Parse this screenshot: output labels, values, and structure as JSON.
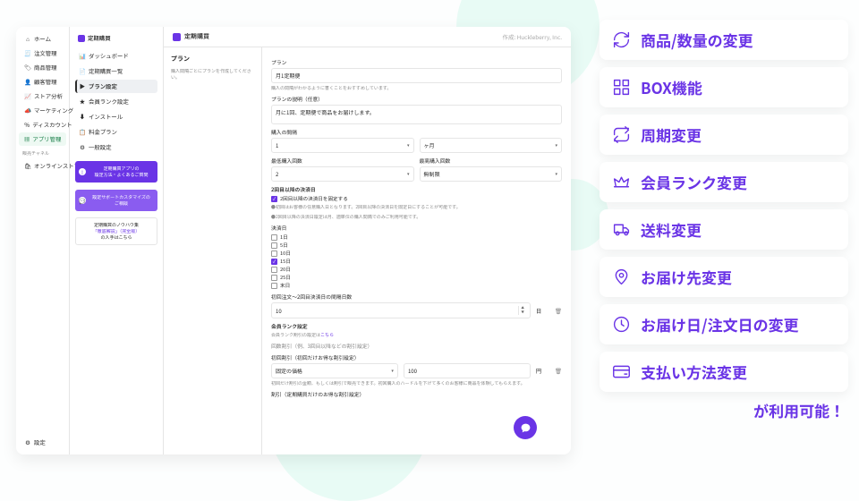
{
  "pnav": {
    "items": [
      {
        "icon": "⌂",
        "label": "ホーム"
      },
      {
        "icon": "🧾",
        "label": "注文管理"
      },
      {
        "icon": "🏷",
        "label": "商品管理"
      },
      {
        "icon": "👤",
        "label": "顧客管理"
      },
      {
        "icon": "📈",
        "label": "ストア分析"
      },
      {
        "icon": "📣",
        "label": "マーケティング"
      },
      {
        "icon": "％",
        "label": "ディスカウント"
      },
      {
        "icon": "▦",
        "label": "アプリ管理",
        "selected": true
      }
    ],
    "channel_label": "販売チャネル",
    "online_store": "オンラインストア",
    "settings": "設定"
  },
  "snav": {
    "app": "定期購買",
    "items": [
      {
        "icon": "📊",
        "label": "ダッシュボード"
      },
      {
        "icon": "📄",
        "label": "定期購買一覧"
      },
      {
        "icon": "▶",
        "label": "プラン設定",
        "selected": true
      },
      {
        "icon": "★",
        "label": "会員ランク設定"
      },
      {
        "icon": "⬇",
        "label": "インストール"
      },
      {
        "icon": "📋",
        "label": "料金プラン"
      },
      {
        "icon": "⚙",
        "label": "一般設定"
      }
    ],
    "promo1": "定期購買アプリの\n設定方法・よくあるご質問",
    "promo2": "設定サポートカスタマイズの\nご相談",
    "note_title": "定期購買のノウハウ集",
    "note_link": "「徹底解説」（完全版）",
    "note_sub": "の入手はこちら"
  },
  "header": {
    "title": "定期購買",
    "maker": "作成: Huckleberry, Inc."
  },
  "left": {
    "title": "プラン",
    "sub": "購入間隔ごとにプランを作成してください。"
  },
  "form": {
    "plan_label": "プラン",
    "plan_value": "月1定期便",
    "plan_hint": "購入の間隔がわかるように書くことをおすすめしています。",
    "desc_label": "プランの説明（任意）",
    "desc_value": "月に1回、定期便で商品をお届けします。",
    "interval_label": "購入の間隔",
    "interval_num": "1",
    "interval_unit": "ヶ月",
    "min_label": "最低購入回数",
    "min_value": "2",
    "max_label": "最高購入回数",
    "max_value": "無制限",
    "bill_header": "2回目以降の決済日",
    "bill_check": "2回目以降の決済日を固定する",
    "bill_note1": "●初回はお客様の任意購入日となります。2回目以降の決済日を固定日にすることが可能です。",
    "bill_note2": "●2回目以降の決済日設定は月、週単位の購入間隔でのみご利用可能です。",
    "bill_day_label": "決済日",
    "days": [
      "1日",
      "5日",
      "10日",
      "15日",
      "20日",
      "25日",
      "末日"
    ],
    "days_checked": 3,
    "gap_label": "初回注文～2回目決済日の間隔日数",
    "gap_value": "10",
    "gap_unit": "日",
    "rank_label": "会員ランク設定",
    "rank_help_prefix": "会員ランク割引の設定は",
    "rank_help_link": "こちら",
    "rdisc_label": "回数割引（例、3回目以降などの割引設定）",
    "first_label": "初回割引（初回だけお得な割引設定）",
    "price_type": "固定の価格",
    "price_value": "100",
    "price_unit": "円",
    "first_help": "初回だけ割引の金額、もしくは割引で販売できます。初回購入のハードルを下げて多くのお客様に商品を体験してもらえます。",
    "disc_label": "割引（定期購買だけのお得な割引設定）"
  },
  "features": [
    {
      "icon": "refresh",
      "label": "商品/数量の変更"
    },
    {
      "icon": "grid",
      "label": "BOX機能"
    },
    {
      "icon": "loop",
      "label": "周期変更"
    },
    {
      "icon": "crown",
      "label": "会員ランク変更"
    },
    {
      "icon": "truck",
      "label": "送料変更"
    },
    {
      "icon": "pin",
      "label": "お届け先変更"
    },
    {
      "icon": "clock",
      "label": "お届け日/注文日の変更"
    },
    {
      "icon": "card",
      "label": "支払い方法変更"
    }
  ],
  "avail": "が利用可能！"
}
